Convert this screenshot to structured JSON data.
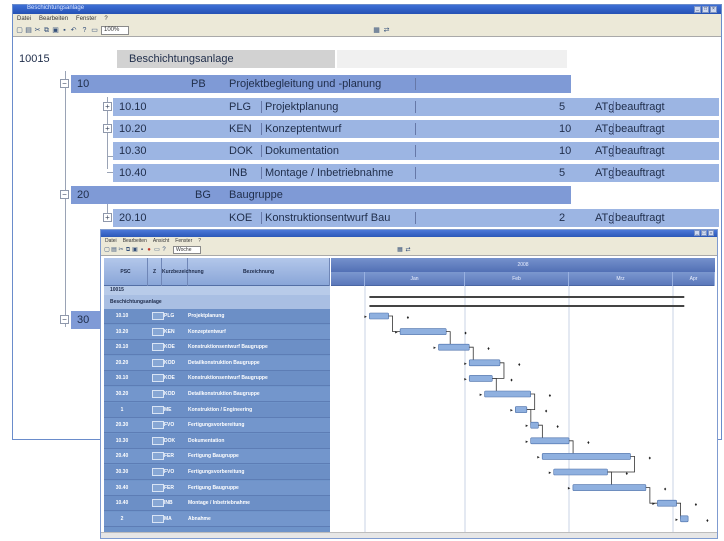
{
  "back_window": {
    "title": "Beschichtungsanlage",
    "menu": [
      "Datei",
      "Bearbeiten",
      "Fenster",
      "?"
    ],
    "zoom_value": "100%",
    "project": {
      "number": "10015",
      "name": "Beschichtungsanlage"
    },
    "tree": [
      {
        "id": "l1",
        "psc": "10",
        "kz": "PB",
        "name": "Projektbegleitung und -planung",
        "kap": "",
        "unit": "",
        "status": ""
      },
      {
        "id": "l2",
        "psc": "10.10",
        "kz": "PLG",
        "name": "Projektplanung",
        "kap": "5",
        "unit": "ATg",
        "status": "beauftragt"
      },
      {
        "id": "l3",
        "psc": "10.20",
        "kz": "KEN",
        "name": "Konzeptentwurf",
        "kap": "10",
        "unit": "ATg",
        "status": "beauftragt"
      },
      {
        "id": "l4",
        "psc": "10.30",
        "kz": "DOK",
        "name": "Dokumentation",
        "kap": "10",
        "unit": "ATg",
        "status": "beauftragt"
      },
      {
        "id": "l5",
        "psc": "10.40",
        "kz": "INB",
        "name": "Montage / Inbetriebnahme",
        "kap": "5",
        "unit": "ATg",
        "status": "beauftragt"
      },
      {
        "id": "l6",
        "psc": "20",
        "kz": "BG",
        "name": "Baugruppe",
        "kap": "",
        "unit": "",
        "status": ""
      },
      {
        "id": "l7",
        "psc": "20.10",
        "kz": "KOE",
        "name": "Konstruktionsentwurf Bau",
        "kap": "2",
        "unit": "ATg",
        "status": "beauftragt"
      },
      {
        "id": "l8",
        "psc": "30",
        "kz": "",
        "name": "",
        "kap": "",
        "unit": "",
        "status": ""
      }
    ]
  },
  "front_window": {
    "menu": [
      "Datei",
      "Bearbeiten",
      "Ansicht",
      "Fenster",
      "?"
    ],
    "zoom_value": "Woche",
    "grid_headers": {
      "psc": "PSC",
      "chk": "Z",
      "kz": "Kurzbezeichnung",
      "bez": "Bezeichnung"
    },
    "group_rows": [
      "10015",
      "Beschichtungsanlage"
    ],
    "gantt_header_top": "2008",
    "gantt_months": [
      "Jan",
      "Feb",
      "Mrz",
      "Apr"
    ],
    "rows": [
      {
        "psc": "10.10",
        "kz": "PLG",
        "bez": "Projektplanung"
      },
      {
        "psc": "10.20",
        "kz": "KEN",
        "bez": "Konzeptentwurf"
      },
      {
        "psc": "20.10",
        "kz": "KOE",
        "bez": "Konstruktionsentwurf Baugruppe"
      },
      {
        "psc": "20.20",
        "kz": "KOD",
        "bez": "Detailkonstruktion Baugruppe"
      },
      {
        "psc": "30.10",
        "kz": "KOE",
        "bez": "Konstruktionsentwurf Baugruppe"
      },
      {
        "psc": "30.20",
        "kz": "KOD",
        "bez": "Detailkonstruktion Baugruppe"
      },
      {
        "psc": "1",
        "kz": "ME",
        "bez": "Konstruktion / Engineering"
      },
      {
        "psc": "20.30",
        "kz": "FVO",
        "bez": "Fertigungsvorbereitung"
      },
      {
        "psc": "10.30",
        "kz": "DOK",
        "bez": "Dokumentation"
      },
      {
        "psc": "20.40",
        "kz": "FER",
        "bez": "Fertigung Baugruppe"
      },
      {
        "psc": "30.30",
        "kz": "FVO",
        "bez": "Fertigungsvorbereitung"
      },
      {
        "psc": "30.40",
        "kz": "FER",
        "bez": "Fertigung Baugruppe"
      },
      {
        "psc": "10.40",
        "kz": "INB",
        "bez": "Montage / Inbetriebnahme"
      },
      {
        "psc": "2",
        "kz": "MA",
        "bez": "Abnahme"
      }
    ],
    "gantt_tasks": [
      {
        "start": 0.1,
        "end": 0.15
      },
      {
        "start": 0.18,
        "end": 0.3
      },
      {
        "start": 0.28,
        "end": 0.36
      },
      {
        "start": 0.36,
        "end": 0.44
      },
      {
        "start": 0.36,
        "end": 0.42
      },
      {
        "start": 0.4,
        "end": 0.52
      },
      {
        "start": 0.48,
        "end": 0.51
      },
      {
        "start": 0.52,
        "end": 0.54
      },
      {
        "start": 0.52,
        "end": 0.62
      },
      {
        "start": 0.55,
        "end": 0.78
      },
      {
        "start": 0.58,
        "end": 0.72
      },
      {
        "start": 0.63,
        "end": 0.82
      },
      {
        "start": 0.85,
        "end": 0.9
      },
      {
        "start": 0.91,
        "end": 0.93
      }
    ],
    "summary_bars": [
      {
        "start": 0.1,
        "end": 0.92
      },
      {
        "start": 0.1,
        "end": 0.92
      }
    ],
    "accent_bar": "#8fb0df",
    "accent_header": "#5d7bbd"
  }
}
